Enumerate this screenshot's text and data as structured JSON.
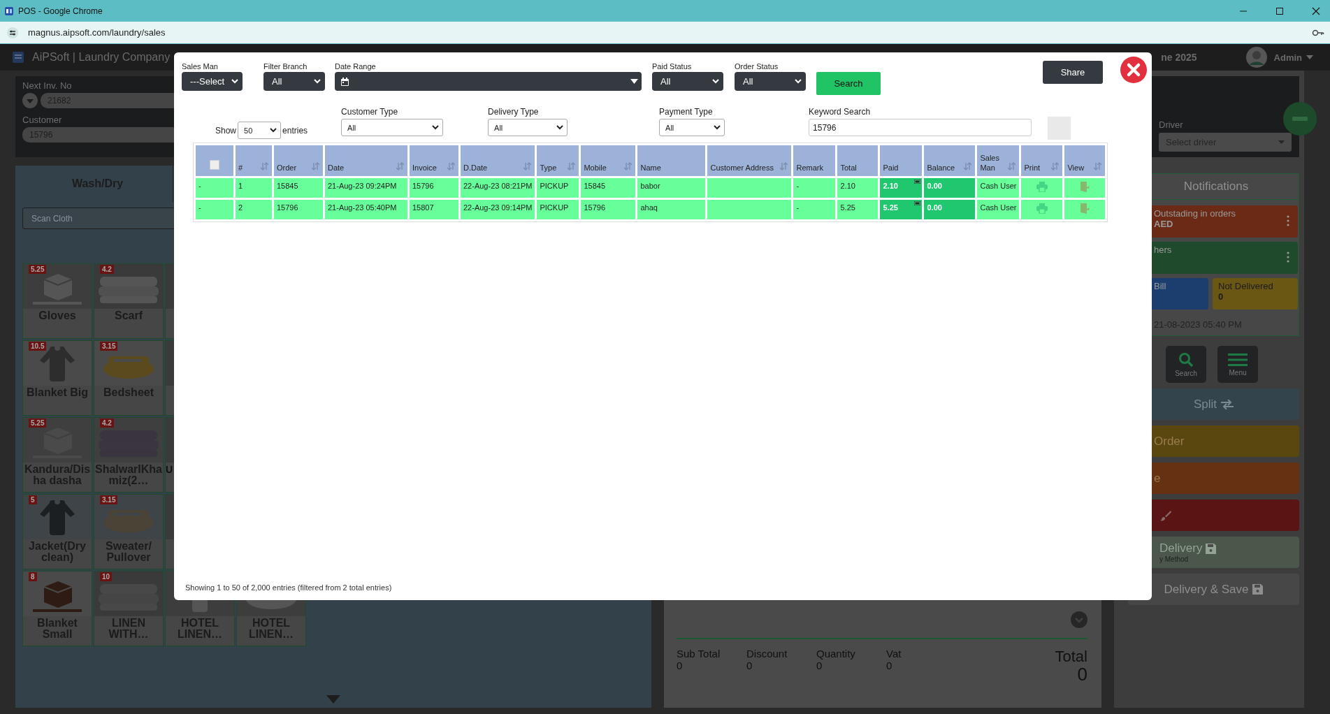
{
  "browser": {
    "title": "POS - Google Chrome",
    "url": "magnus.aipsoft.com/laundry/sales"
  },
  "app_header": {
    "brand": "AiPSoft | Laundry Company",
    "date_fragment": "ne 2025",
    "user": "Admin"
  },
  "invoice_panel": {
    "next_inv_label": "Next Inv. No",
    "next_inv_value": "21682",
    "customer_label": "Customer",
    "customer_value": "15796"
  },
  "product_panel": {
    "tab": "Wash/Dry",
    "scan_placeholder": "Scan Cloth",
    "tile_rows": [
      [
        {
          "kind": "full",
          "name": "Gloves",
          "price": "5.25"
        },
        {
          "kind": "full",
          "name": "Scarf",
          "price": "4.2"
        },
        {
          "kind": "partial"
        }
      ],
      [
        {
          "kind": "full",
          "name": "Blanket Big",
          "price": "10.5"
        },
        {
          "kind": "full",
          "name": "Bedsheet",
          "price": "3.15"
        },
        {
          "kind": "partial"
        }
      ],
      [
        {
          "kind": "full",
          "name": "Kandura/Disha dasha",
          "price": "5.25"
        },
        {
          "kind": "full",
          "name": "ShalwarIKhamiz(2…",
          "price": "4.2"
        },
        {
          "kind": "partial",
          "name": "U"
        }
      ],
      [
        {
          "kind": "full",
          "name": "Jacket(Dry clean)",
          "price": "5"
        },
        {
          "kind": "full",
          "name": "Sweater/ Pullover",
          "price": "3.15"
        },
        {
          "kind": "partial"
        }
      ],
      [
        {
          "kind": "full",
          "name": "Blanket Small",
          "price": "8"
        },
        {
          "kind": "full",
          "name": "LINEN WITH…",
          "price": "10"
        },
        {
          "kind": "full",
          "name": "HOTEL LINEN…"
        },
        {
          "kind": "full",
          "name": "HOTEL LINEN…"
        }
      ]
    ]
  },
  "totals": {
    "items": [
      {
        "label": "Sub Total",
        "value": "0"
      },
      {
        "label": "Discount",
        "value": "0"
      },
      {
        "label": "Quantity",
        "value": "0"
      },
      {
        "label": "Vat",
        "value": "0"
      }
    ],
    "total_label": "Total",
    "total_value": "0"
  },
  "side_panel": {
    "driver_label": "Driver",
    "driver_placeholder": "Select driver",
    "notifications_title": "Notifications",
    "cards": [
      {
        "title": "Outstading in orders",
        "value": "AED",
        "color": "#6a2a16",
        "kind": "wide"
      },
      {
        "title": "hers",
        "color": "#1f4a2b",
        "kind": "wide"
      },
      {
        "title": "Bill",
        "color": "#1c3e6e",
        "kind": "half"
      },
      {
        "title": "Not Delivered",
        "value": "0",
        "color": "#6b5714",
        "kind": "half"
      }
    ],
    "timestamp": "21-08-2023 05:40 PM",
    "tool_buttons": [
      {
        "label": "Search",
        "kind": "search"
      },
      {
        "label": "Menu",
        "kind": "menu"
      }
    ],
    "actions": [
      {
        "label": "Split",
        "kind": "swap",
        "color": "#34444c"
      },
      {
        "label": "Order",
        "kind": "text",
        "color": "#5a470f"
      },
      {
        "label": "e",
        "kind": "text",
        "color": "#663012"
      },
      {
        "kind": "brush",
        "color": "#5a1414"
      },
      {
        "label": "Delivery",
        "sublabel": "y Method",
        "kind": "delivery",
        "color": "#4b574b"
      },
      {
        "label": "Delivery & Save",
        "kind": "save",
        "color": "#474747"
      }
    ]
  },
  "modal": {
    "filters_top": [
      {
        "label": "Sales Man",
        "value": "---Select",
        "kind": "select"
      },
      {
        "label": "Filter Branch",
        "value": "All",
        "kind": "select"
      },
      {
        "label": "Date Range",
        "kind": "date"
      },
      {
        "label": "Paid Status",
        "value": "All",
        "kind": "select"
      },
      {
        "label": "Order Status",
        "value": "All",
        "kind": "select"
      }
    ],
    "search_button": "Search",
    "share_button": "Share",
    "show_label": "Show",
    "page_size": "50",
    "entries_label": "entries",
    "filters_bottom": [
      {
        "label": "Customer Type",
        "value": "All",
        "kind": "select"
      },
      {
        "label": "Delivery Type",
        "value": "All",
        "kind": "select"
      },
      {
        "label": "Payment Type",
        "value": "All",
        "kind": "select"
      },
      {
        "label": "Keyword Search",
        "value": "15796",
        "kind": "text"
      }
    ],
    "table": {
      "columns": [
        {
          "kind": "checkbox",
          "checked": false
        },
        {
          "label": "#",
          "sortable": true
        },
        {
          "label": "Order",
          "sortable": true
        },
        {
          "label": "Date",
          "sortable": true
        },
        {
          "label": "Invoice",
          "sortable": true
        },
        {
          "label": "D.Date",
          "sortable": true
        },
        {
          "label": "Type",
          "sortable": true
        },
        {
          "label": "Mobile",
          "sortable": true
        },
        {
          "label": "Name",
          "sortable": false
        },
        {
          "label": "Customer Address",
          "sortable": true
        },
        {
          "label": "Remark",
          "sortable": false
        },
        {
          "label": "Total",
          "sortable": false
        },
        {
          "label": "Paid",
          "sortable": false,
          "kind": "paid"
        },
        {
          "label": "Balance",
          "sortable": true,
          "kind": "strong"
        },
        {
          "label": "Sales Man",
          "sortable": true
        },
        {
          "label": "Print",
          "kind": "print",
          "sortable": true
        },
        {
          "label": "View",
          "kind": "view",
          "sortable": true
        }
      ],
      "rows": [
        {
          "cells": [
            "-",
            "1",
            "15845",
            "21-Aug-23 09:24PM",
            "15796",
            "22-Aug-23 08:21PM",
            "PICKUP",
            "15845",
            "babor",
            null,
            "-",
            "2.10",
            "2.10",
            "0.00",
            "Cash User"
          ]
        },
        {
          "cells": [
            "-",
            "2",
            "15796",
            "21-Aug-23 05:40PM",
            "15807",
            "22-Aug-23 09:14PM",
            "PICKUP",
            "15796",
            "ahaq",
            null,
            "-",
            "5.25",
            "5.25",
            "0.00",
            "Cash User"
          ]
        }
      ]
    },
    "footer": "Showing 1 to 50 of 2,000 entries (filtered from 2 total entries)"
  }
}
